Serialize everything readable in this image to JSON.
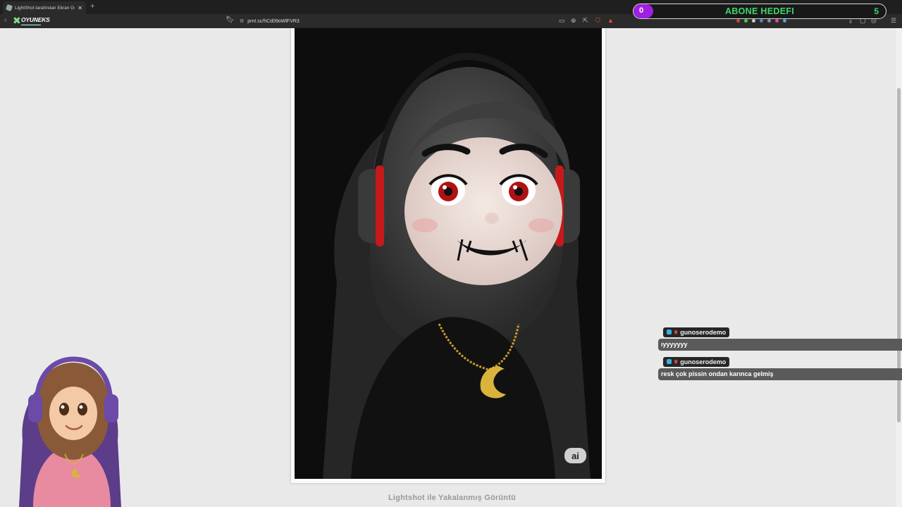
{
  "browser": {
    "tab_title": "LightShot tarafından Ekran Görü",
    "address": "prnt.sc/hCd09oWlFVR3"
  },
  "overlay": {
    "logo_text": "OYUNEKS",
    "goal_label": "ABONE HEDEFI",
    "goal_current": "0",
    "goal_target": "5",
    "goal_progress": 0
  },
  "content": {
    "ai_badge": "ai",
    "caption": "Lightshot ile Yakalanmış Görüntü"
  },
  "chat": {
    "messages": [
      {
        "user": "gunoserodemo",
        "text": "ıyyyyyyy"
      },
      {
        "user": "gunoserodemo",
        "text": "resk çok pissin ondan karınca gelmiş"
      }
    ]
  },
  "colors": {
    "goal_fill": "#a020e0",
    "goal_text": "#3fd66a",
    "page_bg": "#e9e9e9",
    "chat_bubble": "#5a5a5a"
  }
}
